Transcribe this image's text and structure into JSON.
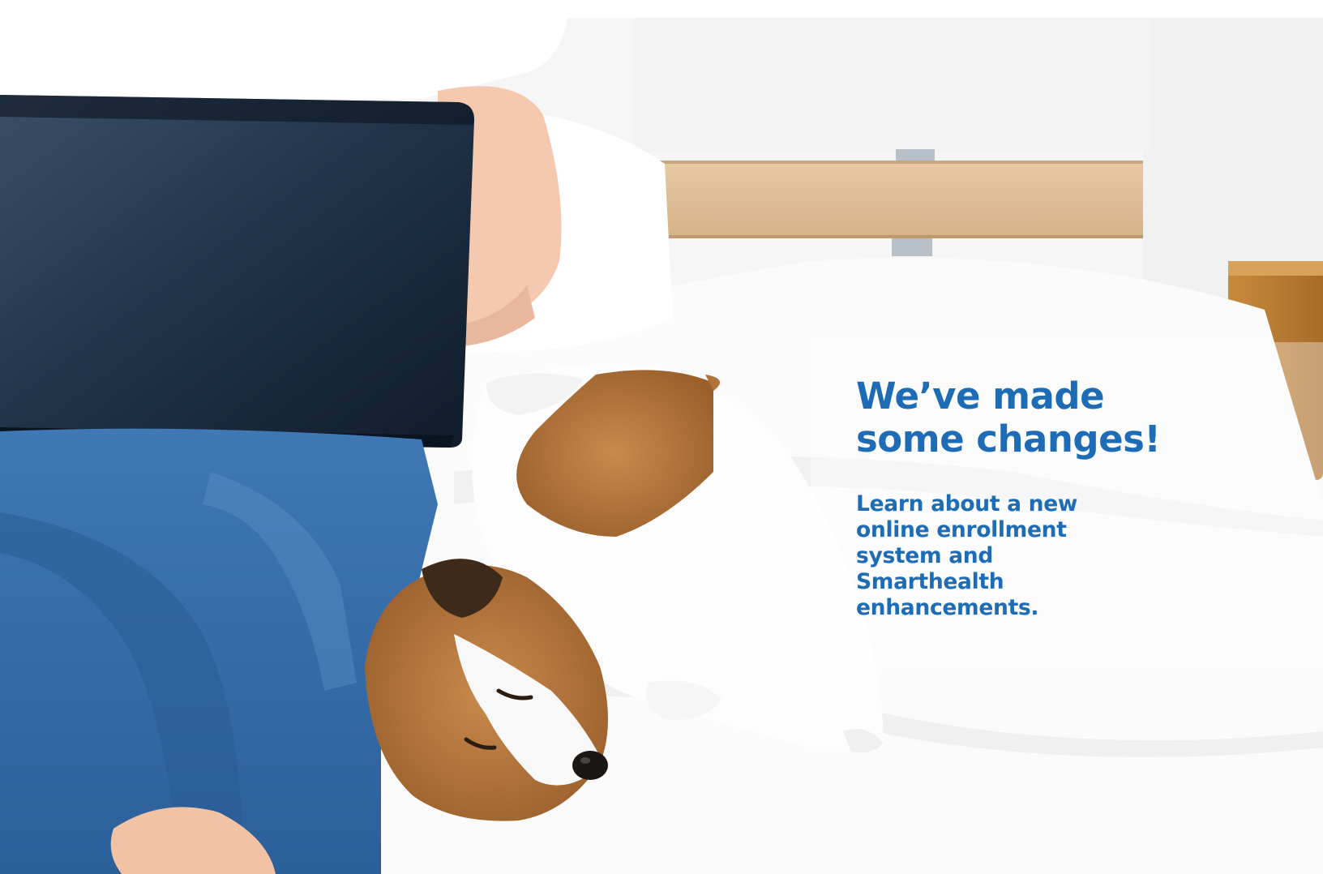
{
  "hero": {
    "image_alt": "person with laptop sitting on a bed next to a sleeping dog",
    "headline_lines": [
      "We’ve made",
      "some changes!"
    ],
    "subhead_lines": [
      "Learn about a new",
      "online enrollment",
      "system and Smarthealth",
      "enhancements."
    ]
  },
  "colors": {
    "accent": "#1e6cb5",
    "background": "#ffffff"
  }
}
